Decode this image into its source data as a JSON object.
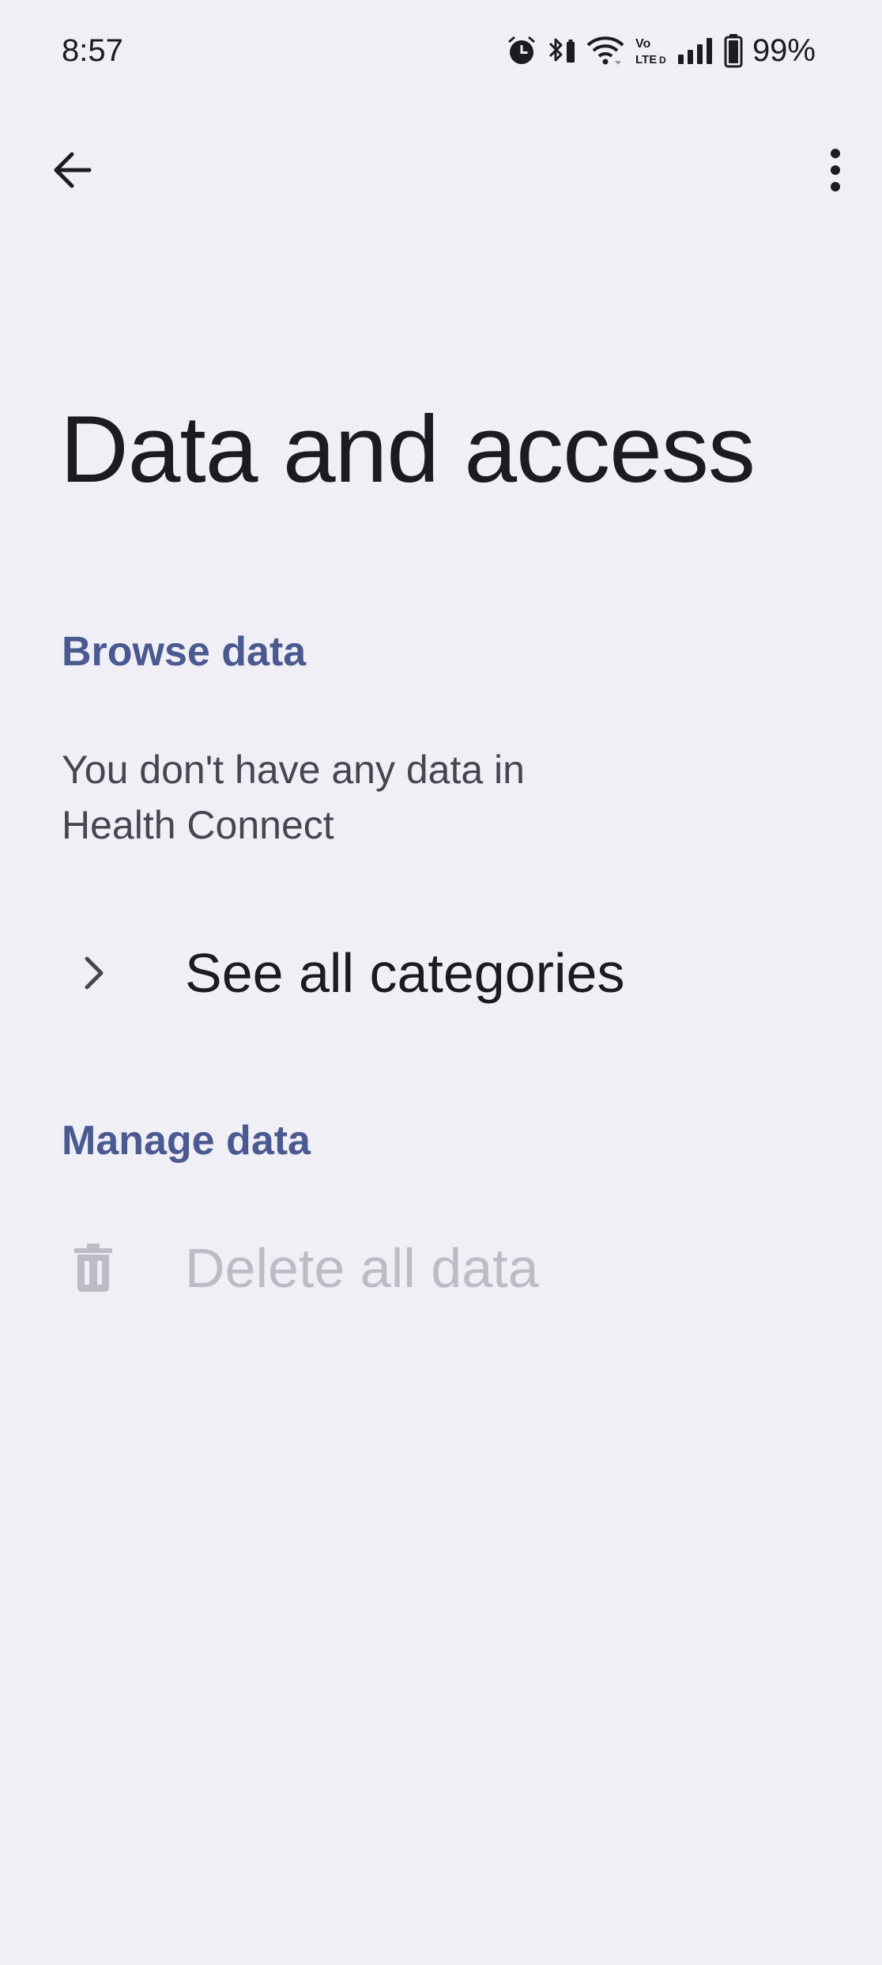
{
  "status_bar": {
    "time": "8:57",
    "battery": "99%",
    "icons": [
      "alarm-icon",
      "bluetooth-battery-icon",
      "wifi-icon",
      "volte-icon",
      "signal-icon",
      "battery-icon"
    ]
  },
  "toolbar": {
    "back_icon": "arrow-back-icon",
    "more_icon": "more-vert-icon"
  },
  "page": {
    "title": "Data and access"
  },
  "browse": {
    "header": "Browse data",
    "empty_message": "You don't have any data in Health Connect",
    "see_all_label": "See all categories",
    "see_all_icon": "chevron-right-icon"
  },
  "manage": {
    "header": "Manage data",
    "delete_label": "Delete all data",
    "delete_icon": "trash-icon",
    "delete_enabled": false
  },
  "colors": {
    "background": "#f0eff6",
    "section_header": "#4a5a90",
    "text_primary": "#1c1b1f",
    "text_secondary": "#46464f",
    "text_disabled": "#bdbcc4"
  }
}
